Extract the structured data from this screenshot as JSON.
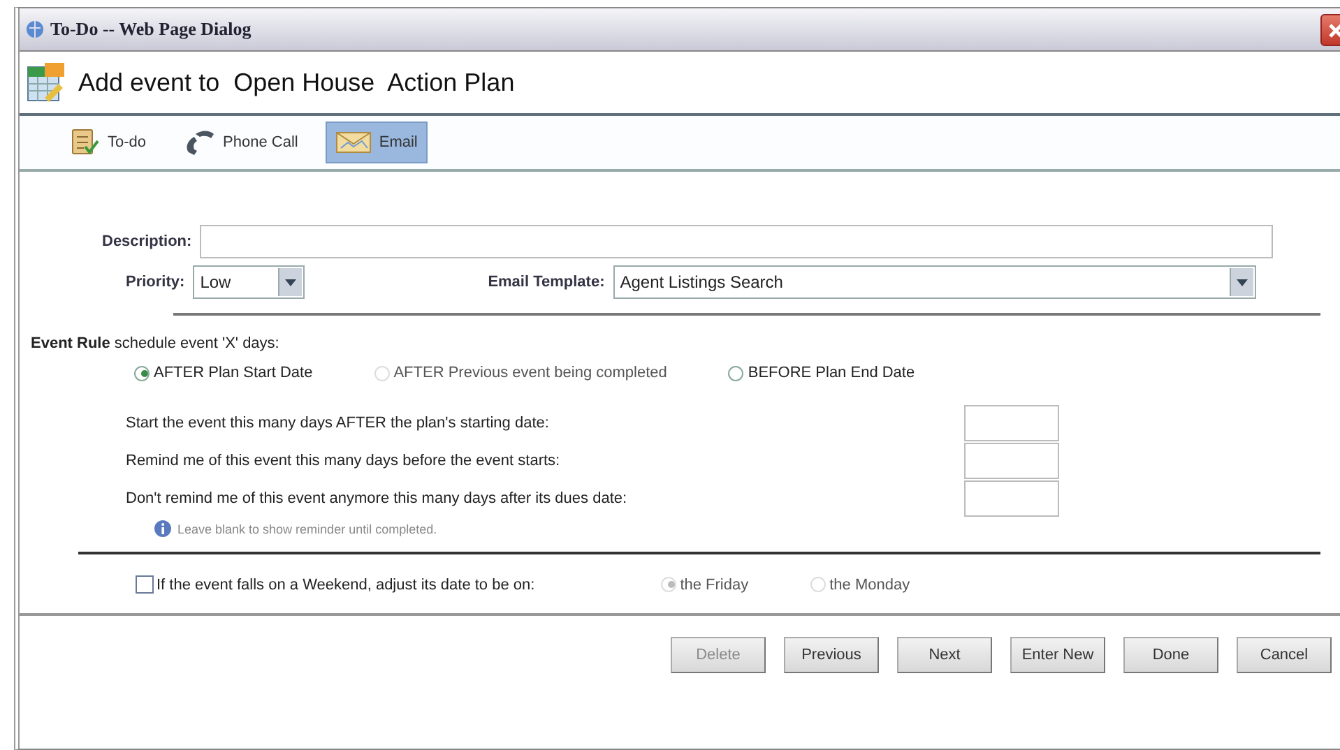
{
  "window": {
    "title": "To-Do -- Web Page Dialog"
  },
  "header": {
    "title": "Add event to  Open House  Action Plan"
  },
  "tabs": [
    {
      "label": "To-do",
      "kind": "todo",
      "selected": false
    },
    {
      "label": "Phone Call",
      "kind": "phone",
      "selected": false
    },
    {
      "label": "Email",
      "kind": "email",
      "selected": true
    }
  ],
  "form": {
    "description": {
      "label": "Description:"
    },
    "priority": {
      "label": "Priority:",
      "value": "Low"
    },
    "email_template": {
      "label": "Email Template:",
      "value": "Agent Listings Search"
    }
  },
  "event_rule": {
    "title": "Event Rule",
    "subtitle": "schedule event 'X' days:",
    "options": [
      {
        "label": "AFTER Plan Start Date",
        "selected": true,
        "disabled": false
      },
      {
        "label": "AFTER Previous event being completed",
        "selected": false,
        "disabled": true
      },
      {
        "label": "BEFORE Plan End Date",
        "selected": false,
        "disabled": false
      }
    ],
    "fields": [
      {
        "label": "Start the event this many days AFTER the plan's starting date:"
      },
      {
        "label": "Remind me of this event this many days before the event starts:"
      },
      {
        "label": "Don't remind me of this event anymore this many days after its dues date:"
      }
    ],
    "hint": "Leave blank to show reminder until completed."
  },
  "weekend": {
    "label": "If the event falls on a Weekend, adjust its date to be on:",
    "checked": false,
    "options": [
      {
        "label": "the Friday",
        "selected": true,
        "disabled": true
      },
      {
        "label": "the Monday",
        "selected": false,
        "disabled": true
      }
    ]
  },
  "buttons": [
    {
      "label": "Delete",
      "disabled": true
    },
    {
      "label": "Previous",
      "disabled": false
    },
    {
      "label": "Next",
      "disabled": false
    },
    {
      "label": "Enter New",
      "disabled": false
    },
    {
      "label": "Done",
      "disabled": false
    },
    {
      "label": "Cancel",
      "disabled": false
    }
  ]
}
